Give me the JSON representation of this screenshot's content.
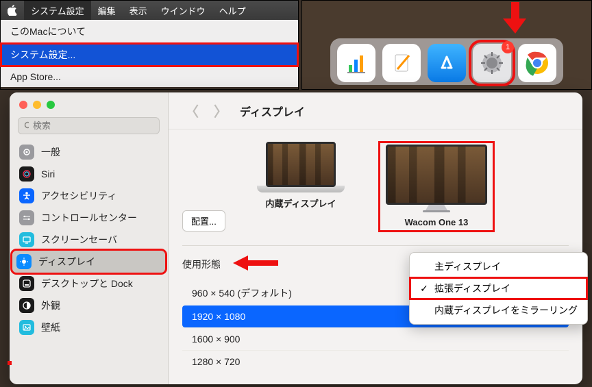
{
  "menubar": {
    "items": [
      "システム設定",
      "編集",
      "表示",
      "ウインドウ",
      "ヘルプ"
    ],
    "dropdown": {
      "about": "このMacについて",
      "settings": "システム設定...",
      "appstore": "App Store..."
    }
  },
  "dock": {
    "badge": "1"
  },
  "window": {
    "title": "ディスプレイ",
    "search_placeholder": "検索",
    "sidebar": [
      {
        "label": "一般",
        "icon": "gear",
        "bg": "#9a9a9e"
      },
      {
        "label": "Siri",
        "icon": "siri",
        "bg": "#1a1a1a"
      },
      {
        "label": "アクセシビリティ",
        "icon": "access",
        "bg": "#0a66ff"
      },
      {
        "label": "コントロールセンター",
        "icon": "control",
        "bg": "#9a9a9e"
      },
      {
        "label": "スクリーンセーバ",
        "icon": "ssaver",
        "bg": "#22bcde"
      },
      {
        "label": "ディスプレイ",
        "icon": "display",
        "bg": "#0a8bff"
      },
      {
        "label": "デスクトップと Dock",
        "icon": "dock",
        "bg": "#1a1a1a"
      },
      {
        "label": "外観",
        "icon": "appear",
        "bg": "#1a1a1a"
      },
      {
        "label": "壁紙",
        "icon": "wallpaper",
        "bg": "#22bcde"
      }
    ],
    "selected_sidebar": 5,
    "arrange_btn": "配置...",
    "displays": {
      "internal": "内蔵ディスプレイ",
      "external": "Wacom One 13"
    },
    "usage_label": "使用形態",
    "resolutions": [
      "960 × 540 (デフォルト)",
      "1920 × 1080",
      "1600 × 900",
      "1280 × 720"
    ],
    "selected_resolution": 1,
    "popup": {
      "main": "主ディスプレイ",
      "extended": "拡張ディスプレイ",
      "mirror": "内蔵ディスプレイをミラーリング"
    }
  }
}
